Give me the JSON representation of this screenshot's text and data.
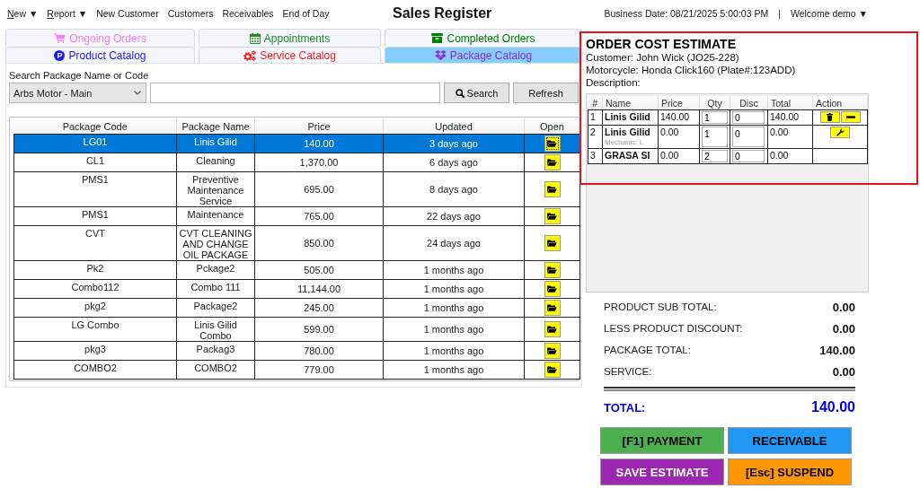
{
  "menu": [
    {
      "label": "New",
      "mnemonic": true,
      "caret": "▼"
    },
    {
      "label": "Report",
      "mnemonic": true,
      "caret": "▼"
    },
    {
      "label": "New Customer",
      "mnemonic": false
    },
    {
      "label": "Customers",
      "mnemonic": false
    },
    {
      "label": "Receivables",
      "mnemonic": false
    },
    {
      "label": "End of Day",
      "mnemonic": false
    }
  ],
  "window": {
    "title": "Sales Register"
  },
  "session": {
    "business_date": "Business Date: 08/21/2025 5:00:03 PM",
    "separator": "|",
    "user": "Welcome demo",
    "user_caret": "▼"
  },
  "tab_rows": [
    {
      "tabs": [
        {
          "label": "Ongoing Orders",
          "color": "#ee82ee",
          "selected": false
        },
        {
          "label": "Appointments",
          "color": "#228b22",
          "selected": false
        },
        {
          "label": "Completed Orders",
          "color": "#008000",
          "selected": false
        }
      ]
    },
    {
      "tabs": [
        {
          "label": "Product Catalog",
          "color": "#1a1aff",
          "selected": false,
          "badge": "P"
        },
        {
          "label": "Service Catalog",
          "color": "#ff1a1a",
          "selected": false
        },
        {
          "label": "Package Catalog",
          "color": "#8a2be2",
          "selected": true
        }
      ]
    }
  ],
  "search": {
    "label": "Search Package Name or Code",
    "branch": "Arbs Motor - Main",
    "search_button": "Search",
    "refresh_button": "Refresh"
  },
  "packages": {
    "columns": [
      "Package Code",
      "Package Name",
      "Price",
      "Updated",
      "Open"
    ],
    "rows": [
      {
        "code": "LG01",
        "name": "Linis Gilid",
        "price": "140.00",
        "updated": "3 days ago",
        "selected": true
      },
      {
        "code": "CL1",
        "name": "Cleaning",
        "price": "1,370.00",
        "updated": "6 days ago",
        "selected": false
      },
      {
        "code": "PMS1",
        "name": "Preventive Maintenance Service",
        "price": "695.00",
        "updated": "8 days ago",
        "selected": false
      },
      {
        "code": "PMS1",
        "name": "Maintenance",
        "price": "765.00",
        "updated": "22 days ago",
        "selected": false
      },
      {
        "code": "CVT",
        "name": "CVT CLEANING AND CHANGE OIL PACKAGE",
        "price": "850.00",
        "updated": "24 days ago",
        "selected": false
      },
      {
        "code": "Pk2",
        "name": "Pckage2",
        "price": "505.00",
        "updated": "1 months ago",
        "selected": false
      },
      {
        "code": "Combo112",
        "name": "Combo 111",
        "price": "11,144.00",
        "updated": "1 months ago",
        "selected": false
      },
      {
        "code": "pkg2",
        "name": "Package2",
        "price": "245.00",
        "updated": "1 months ago",
        "selected": false
      },
      {
        "code": "LG Combo",
        "name": "Linis Gilid Combo",
        "price": "599.00",
        "updated": "1 months ago",
        "selected": false
      },
      {
        "code": "pkg3",
        "name": "Packag3",
        "price": "780.00",
        "updated": "1 months ago",
        "selected": false
      },
      {
        "code": "COMBO2",
        "name": "COMBO2",
        "price": "779.00",
        "updated": "1 months ago",
        "selected": false
      }
    ]
  },
  "estimate": {
    "title": "ORDER COST ESTIMATE",
    "customer": "Customer: John Wick (JO25-228)",
    "motorcycle": "Motorcycle: Honda Click160 (Plate#:123ADD)",
    "description": "Description:",
    "columns": [
      "#",
      "Name",
      "Price",
      "Qty",
      "Disc",
      "Total",
      "Action"
    ],
    "items": [
      {
        "no": "1",
        "name": "Linis Gilid",
        "price": "140.00",
        "qty": "1",
        "disc": "0",
        "total": "140.00",
        "actions": [
          {
            "kind": "delete"
          },
          {
            "kind": "decrease"
          }
        ]
      },
      {
        "no": "2",
        "name": "Linis Gilid",
        "mechanic": "Mechanic: L",
        "price": "0.00",
        "qty": "1",
        "disc": "0",
        "total": "0.00",
        "actions": [
          {
            "kind": "tool"
          }
        ]
      },
      {
        "no": "3",
        "name": "GRASA SI",
        "price": "0.00",
        "qty": "2",
        "disc": "0",
        "total": "0.00"
      }
    ]
  },
  "totals": [
    {
      "label": "PRODUCT SUB TOTAL:",
      "value": "0.00"
    },
    {
      "label": "LESS PRODUCT DISCOUNT:",
      "value": "0.00"
    },
    {
      "label": "PACKAGE TOTAL:",
      "value": "140.00"
    },
    {
      "label": "SERVICE:",
      "value": "0.00"
    }
  ],
  "grand_total": {
    "label": "TOTAL:",
    "value": "140.00"
  },
  "actions": [
    {
      "label": "[F1] PAYMENT",
      "color": "#4caf50"
    },
    {
      "label": "RECEIVABLE",
      "color": "#2196f3"
    },
    {
      "label": "SAVE ESTIMATE",
      "color": "#9c27b0"
    },
    {
      "label": "[Esc] SUSPEND",
      "color": "#ff9800"
    }
  ]
}
